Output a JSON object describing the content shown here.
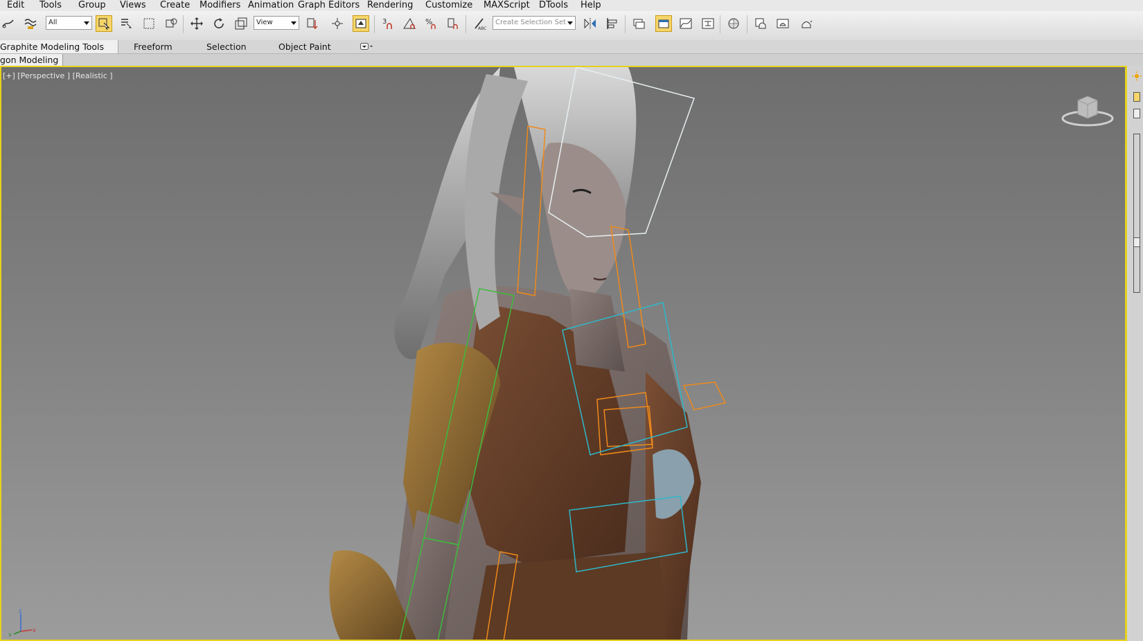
{
  "menu": {
    "items": [
      "Edit",
      "Tools",
      "Group",
      "Views",
      "Create",
      "Modifiers",
      "Animation",
      "Graph Editors",
      "Rendering",
      "Customize",
      "MAXScript",
      "DTools",
      "Help"
    ]
  },
  "toolbar": {
    "filter_value": "All",
    "refcoord_value": "View",
    "selection_set_placeholder": "Create Selection Set"
  },
  "ribbon": {
    "tabs": [
      "Graphite Modeling Tools",
      "Freeform",
      "Selection",
      "Object Paint"
    ],
    "subtab": "gon Modeling"
  },
  "viewport": {
    "label": "[+] [Perspective ] [Realistic ]"
  },
  "icons": {
    "viewcube": "viewcube-icon",
    "axis_tripod": "axis-tripod-icon"
  },
  "colors": {
    "active_viewport_border": "#e6d21d",
    "active_tool": "#f6d66a",
    "bone_orange": "#f08a1a",
    "bone_cyan": "#2fb7c9",
    "bone_green": "#3dbb3d"
  }
}
